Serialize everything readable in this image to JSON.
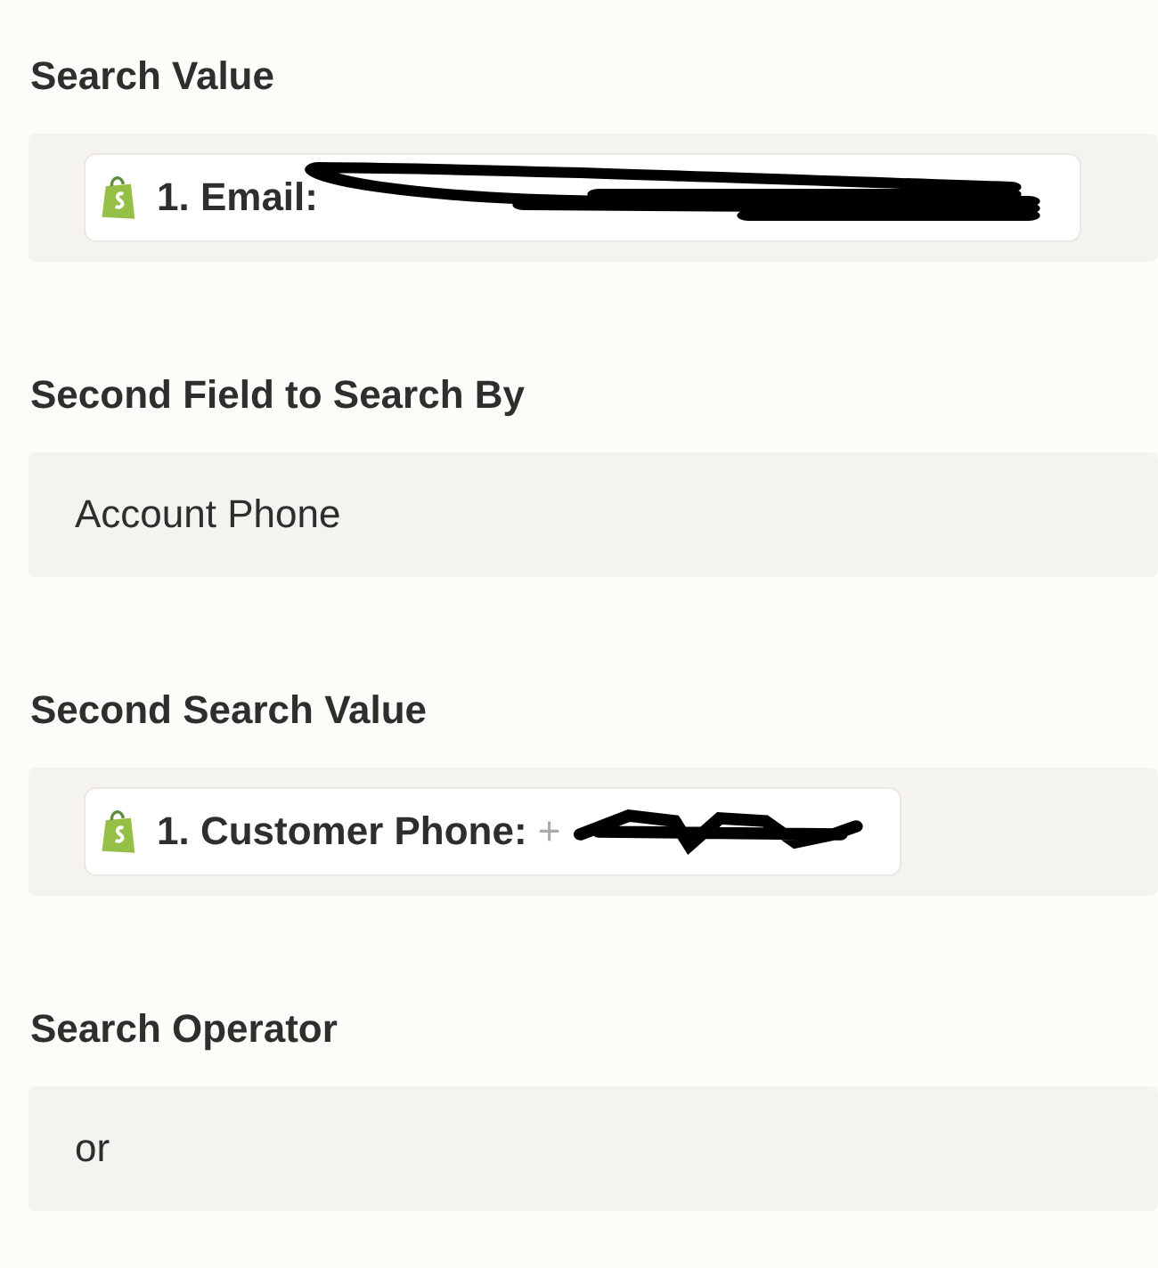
{
  "fields": [
    {
      "label": "Search Value",
      "kind": "pill",
      "pill_label": "1. Email:",
      "redacted": true
    },
    {
      "label": "Second Field to Search By",
      "kind": "text",
      "value": "Account Phone"
    },
    {
      "label": "Second Search Value",
      "kind": "pill",
      "pill_label": "1. Customer Phone:",
      "pill_value": "+",
      "redacted": true
    },
    {
      "label": "Search Operator",
      "kind": "text",
      "value": "or"
    }
  ]
}
